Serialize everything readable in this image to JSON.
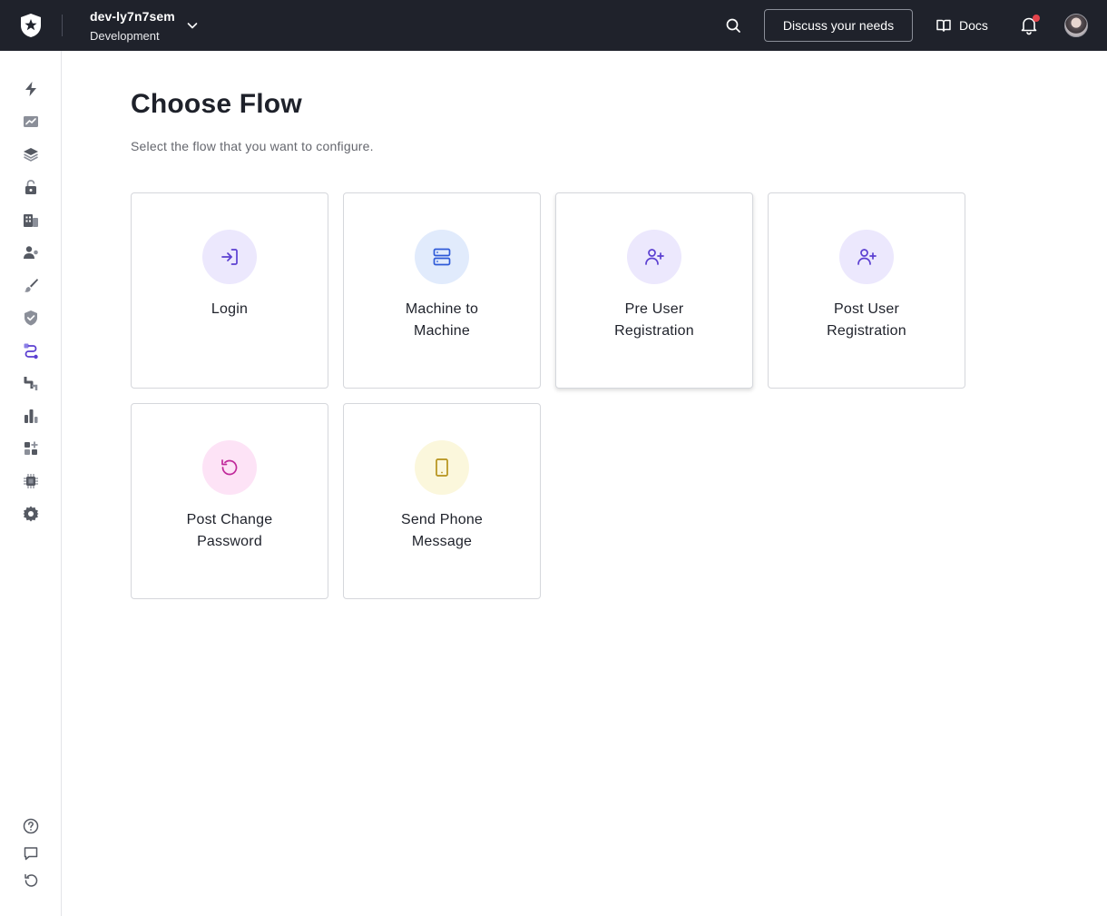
{
  "header": {
    "tenant_name": "dev-ly7n7sem",
    "tenant_env": "Development",
    "discuss_label": "Discuss your needs",
    "docs_label": "Docs"
  },
  "sidebar": {
    "items": [
      {
        "icon": "lightning-icon"
      },
      {
        "icon": "activity-chart-icon"
      },
      {
        "icon": "layers-icon"
      },
      {
        "icon": "lock-icon"
      },
      {
        "icon": "organizations-icon"
      },
      {
        "icon": "user-management-icon"
      },
      {
        "icon": "brush-icon"
      },
      {
        "icon": "shield-icon"
      },
      {
        "icon": "actions-icon"
      },
      {
        "icon": "pipeline-icon"
      },
      {
        "icon": "bar-chart-icon"
      },
      {
        "icon": "extensions-icon"
      },
      {
        "icon": "chip-icon"
      },
      {
        "icon": "gear-icon"
      }
    ],
    "bottom_items": [
      {
        "icon": "help-icon"
      },
      {
        "icon": "chat-icon"
      },
      {
        "icon": "history-icon"
      }
    ],
    "active_item": "actions-icon"
  },
  "main": {
    "title": "Choose Flow",
    "subtitle": "Select the flow that you want to configure.",
    "cards": [
      {
        "line1": "Login",
        "line2": "",
        "icon": "login-icon",
        "bg": "#ece8fd",
        "fg": "#5b3fd1"
      },
      {
        "line1": "Machine to",
        "line2": "Machine",
        "icon": "server-icon",
        "bg": "#e1ebfc",
        "fg": "#2e5ad8"
      },
      {
        "line1": "Pre User",
        "line2": "Registration",
        "icon": "user-plus-icon",
        "bg": "#ece8fd",
        "fg": "#5b3fd1"
      },
      {
        "line1": "Post User",
        "line2": "Registration",
        "icon": "user-plus-icon",
        "bg": "#ece8fd",
        "fg": "#5b3fd1"
      },
      {
        "line1": "Post Change",
        "line2": "Password",
        "icon": "rotate-ccw-icon",
        "bg": "#fde3f6",
        "fg": "#c0289a"
      },
      {
        "line1": "Send Phone",
        "line2": "Message",
        "icon": "tablet-icon",
        "bg": "#fbf7dc",
        "fg": "#b5921a"
      }
    ]
  }
}
